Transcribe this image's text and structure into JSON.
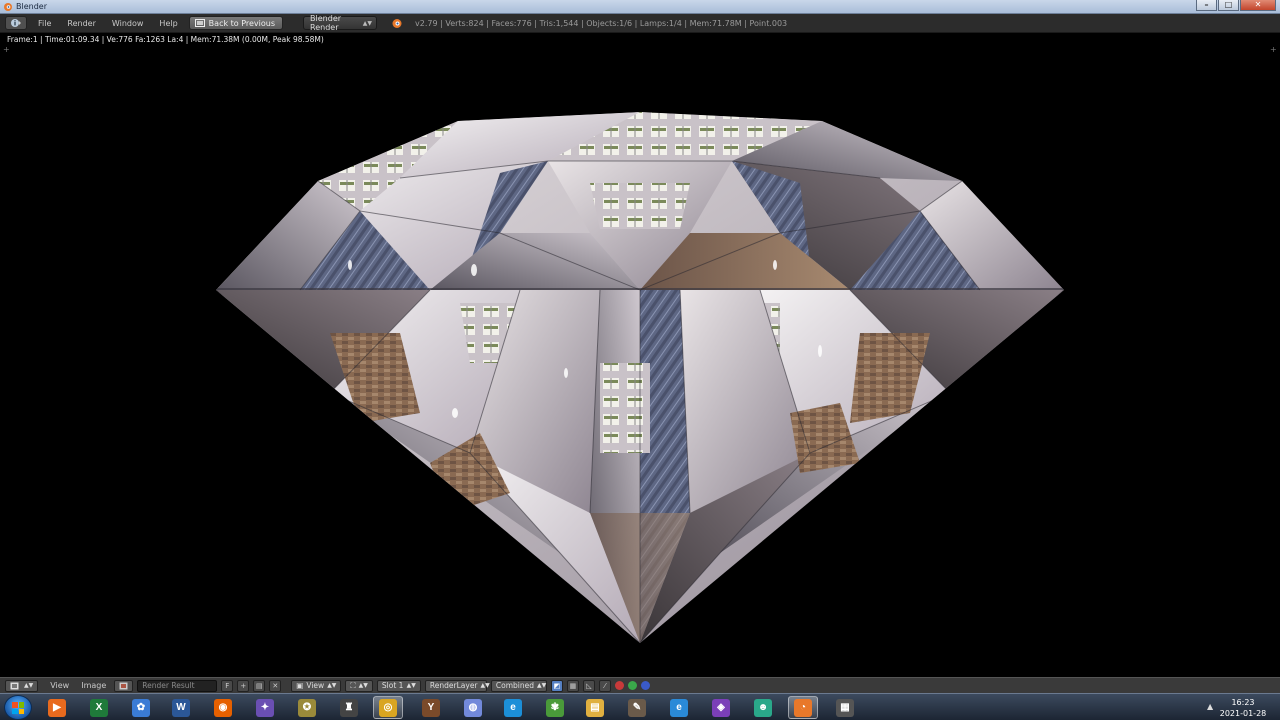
{
  "window": {
    "title": "Blender"
  },
  "titlebar": {
    "minimize": "–",
    "maximize": "□",
    "close": "✕"
  },
  "header": {
    "menus": [
      "File",
      "Render",
      "Window",
      "Help"
    ],
    "back_button": "Back to Previous",
    "engine": "Blender Render",
    "stats": "v2.79 | Verts:824 | Faces:776 | Tris:1,544 | Objects:1/6 | Lamps:1/4 | Mem:71.78M | Point.003"
  },
  "viewport": {
    "render_info": "Frame:1 | Time:01:09.34 | Ve:776 Fa:1263 La:4 | Mem:71.38M (0.00M, Peak 98.58M)",
    "corner_marks": [
      "+",
      "+"
    ]
  },
  "image_editor": {
    "menus": [
      "View",
      "Image"
    ],
    "image_name": "Render Result",
    "fake_user_flag": "F",
    "view_select": "View",
    "slot_select": "Slot 1",
    "layer_select": "RenderLayer",
    "pass_select": "Combined"
  },
  "taskbar": {
    "icons": [
      {
        "name": "media-player-icon",
        "glyph": "▶",
        "color": "#e86a1e"
      },
      {
        "name": "excel-icon",
        "glyph": "X",
        "color": "#1f7a3a"
      },
      {
        "name": "paint-icon",
        "glyph": "✿",
        "color": "#3a7bd5"
      },
      {
        "name": "word-icon",
        "glyph": "W",
        "color": "#2b5797"
      },
      {
        "name": "firefox-icon",
        "glyph": "◉",
        "color": "#e66000"
      },
      {
        "name": "molecule-icon",
        "glyph": "✦",
        "color": "#6a4fb3"
      },
      {
        "name": "medal-icon",
        "glyph": "✪",
        "color": "#9a8a3a"
      },
      {
        "name": "game-icon",
        "glyph": "♜",
        "color": "#444444"
      },
      {
        "name": "chrome-icon",
        "glyph": "◎",
        "color": "#d9a521"
      },
      {
        "name": "app-y-icon",
        "glyph": "Y",
        "color": "#7a4a2a"
      },
      {
        "name": "discord-icon",
        "glyph": "◍",
        "color": "#7289da"
      },
      {
        "name": "edge-icon",
        "glyph": "e",
        "color": "#1c8fd8"
      },
      {
        "name": "plant-icon",
        "glyph": "✾",
        "color": "#4a9a3a"
      },
      {
        "name": "folder-icon",
        "glyph": "▤",
        "color": "#e0b040"
      },
      {
        "name": "gimp-icon",
        "glyph": "✎",
        "color": "#6a5a4a"
      },
      {
        "name": "ie-icon",
        "glyph": "e",
        "color": "#2a8ad8"
      },
      {
        "name": "visual-studio-icon",
        "glyph": "◈",
        "color": "#7b3fb8"
      },
      {
        "name": "robot-icon",
        "glyph": "☻",
        "color": "#2aa88a"
      },
      {
        "name": "blender-icon",
        "glyph": "◔",
        "color": "#e8782a"
      },
      {
        "name": "printer-icon",
        "glyph": "▦",
        "color": "#555555"
      }
    ],
    "clock_time": "16:23",
    "clock_date": "2021-01-28"
  }
}
